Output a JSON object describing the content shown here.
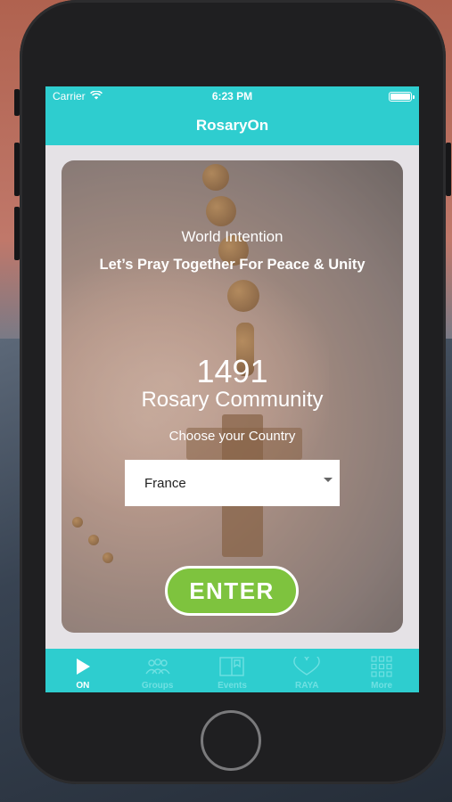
{
  "status_bar": {
    "carrier": "Carrier",
    "time": "6:23 PM"
  },
  "app": {
    "title": "RosaryOn"
  },
  "main": {
    "intention_label": "World Intention",
    "intention_text": "Let’s Pray Together For Peace & Unity",
    "community_count": "1491",
    "community_label": "Rosary Community",
    "choose_label": "Choose your Country",
    "country_selected": "France",
    "enter_label": "ENTER"
  },
  "tabs": [
    {
      "label": "ON",
      "icon": "play-icon",
      "active": true
    },
    {
      "label": "Groups",
      "icon": "groups-icon",
      "active": false
    },
    {
      "label": "Events",
      "icon": "events-icon",
      "active": false
    },
    {
      "label": "RAYA",
      "icon": "heart-icon",
      "active": false
    },
    {
      "label": "More",
      "icon": "grid-icon",
      "active": false
    }
  ],
  "colors": {
    "accent": "#2ecdcf",
    "enter_green": "#7ec33e"
  }
}
